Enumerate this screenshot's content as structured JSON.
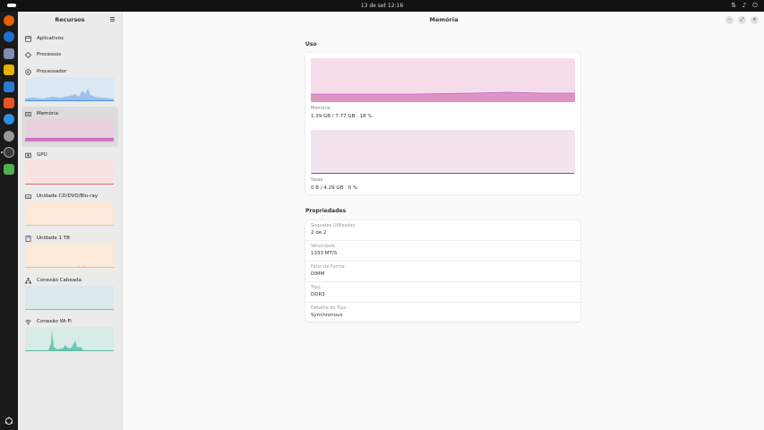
{
  "topbar": {
    "clock": "13 de set  12:16"
  },
  "dock": {
    "apps": [
      {
        "name": "firefox-icon",
        "color": "#e66000"
      },
      {
        "name": "thunderbird-icon",
        "color": "#1f6fd0"
      },
      {
        "name": "files-icon",
        "color": "#7d8fb0"
      },
      {
        "name": "rhythmbox-icon",
        "color": "#e8b100"
      },
      {
        "name": "writer-icon",
        "color": "#2a7bd4"
      },
      {
        "name": "app-center-icon",
        "color": "#e95420"
      },
      {
        "name": "help-icon",
        "color": "#2f8fe0"
      },
      {
        "name": "disc-icon",
        "color": "#888888"
      },
      {
        "name": "resources-icon",
        "color": "#3a3a3a"
      },
      {
        "name": "trash-icon",
        "color": "#4caf50"
      }
    ]
  },
  "sidebar": {
    "title": "Recursos",
    "items": [
      {
        "label": "Aplicativos",
        "icon": "apps-icon"
      },
      {
        "label": "Processos",
        "icon": "processes-icon"
      },
      {
        "label": "Processador",
        "icon": "cpu-icon"
      },
      {
        "label": "Memória",
        "icon": "memory-icon"
      },
      {
        "label": "GPU",
        "icon": "gpu-icon"
      },
      {
        "label": "Unidade CD/DVD/Blu-ray",
        "icon": "disc-drive-icon"
      },
      {
        "label": "Unidade 1 TB",
        "icon": "drive-icon"
      },
      {
        "label": "Conexão Cabeada",
        "icon": "network-icon"
      },
      {
        "label": "Conexão Wi-Fi",
        "icon": "wifi-icon"
      }
    ]
  },
  "main": {
    "title": "Memória",
    "usage": {
      "title": "Uso",
      "memory_caption": "Memória",
      "memory_value": "1.39 GB / 7.77 GB · 18 %",
      "memory_percent": 18,
      "swap_caption": "Swap",
      "swap_value": "0 B / 4.29 GB · 0 %",
      "swap_percent": 0
    },
    "properties": {
      "title": "Propriedades",
      "items": [
        {
          "key": "Soquetes Utilizados",
          "value": "2 de 2"
        },
        {
          "key": "Velocidade",
          "value": "1333 MT/S"
        },
        {
          "key": "Fator de Forma",
          "value": "DIMM"
        },
        {
          "key": "Tipo",
          "value": "DDR3"
        },
        {
          "key": "Detalhe do Tipo",
          "value": "Synchronous"
        }
      ]
    }
  },
  "colors": {
    "cpu": "#4a90d9",
    "memory": "#c061cb",
    "gpu": "#e01b24",
    "drive": "#ff7800",
    "network": "#2ec27e",
    "wifi": "#26a269"
  }
}
